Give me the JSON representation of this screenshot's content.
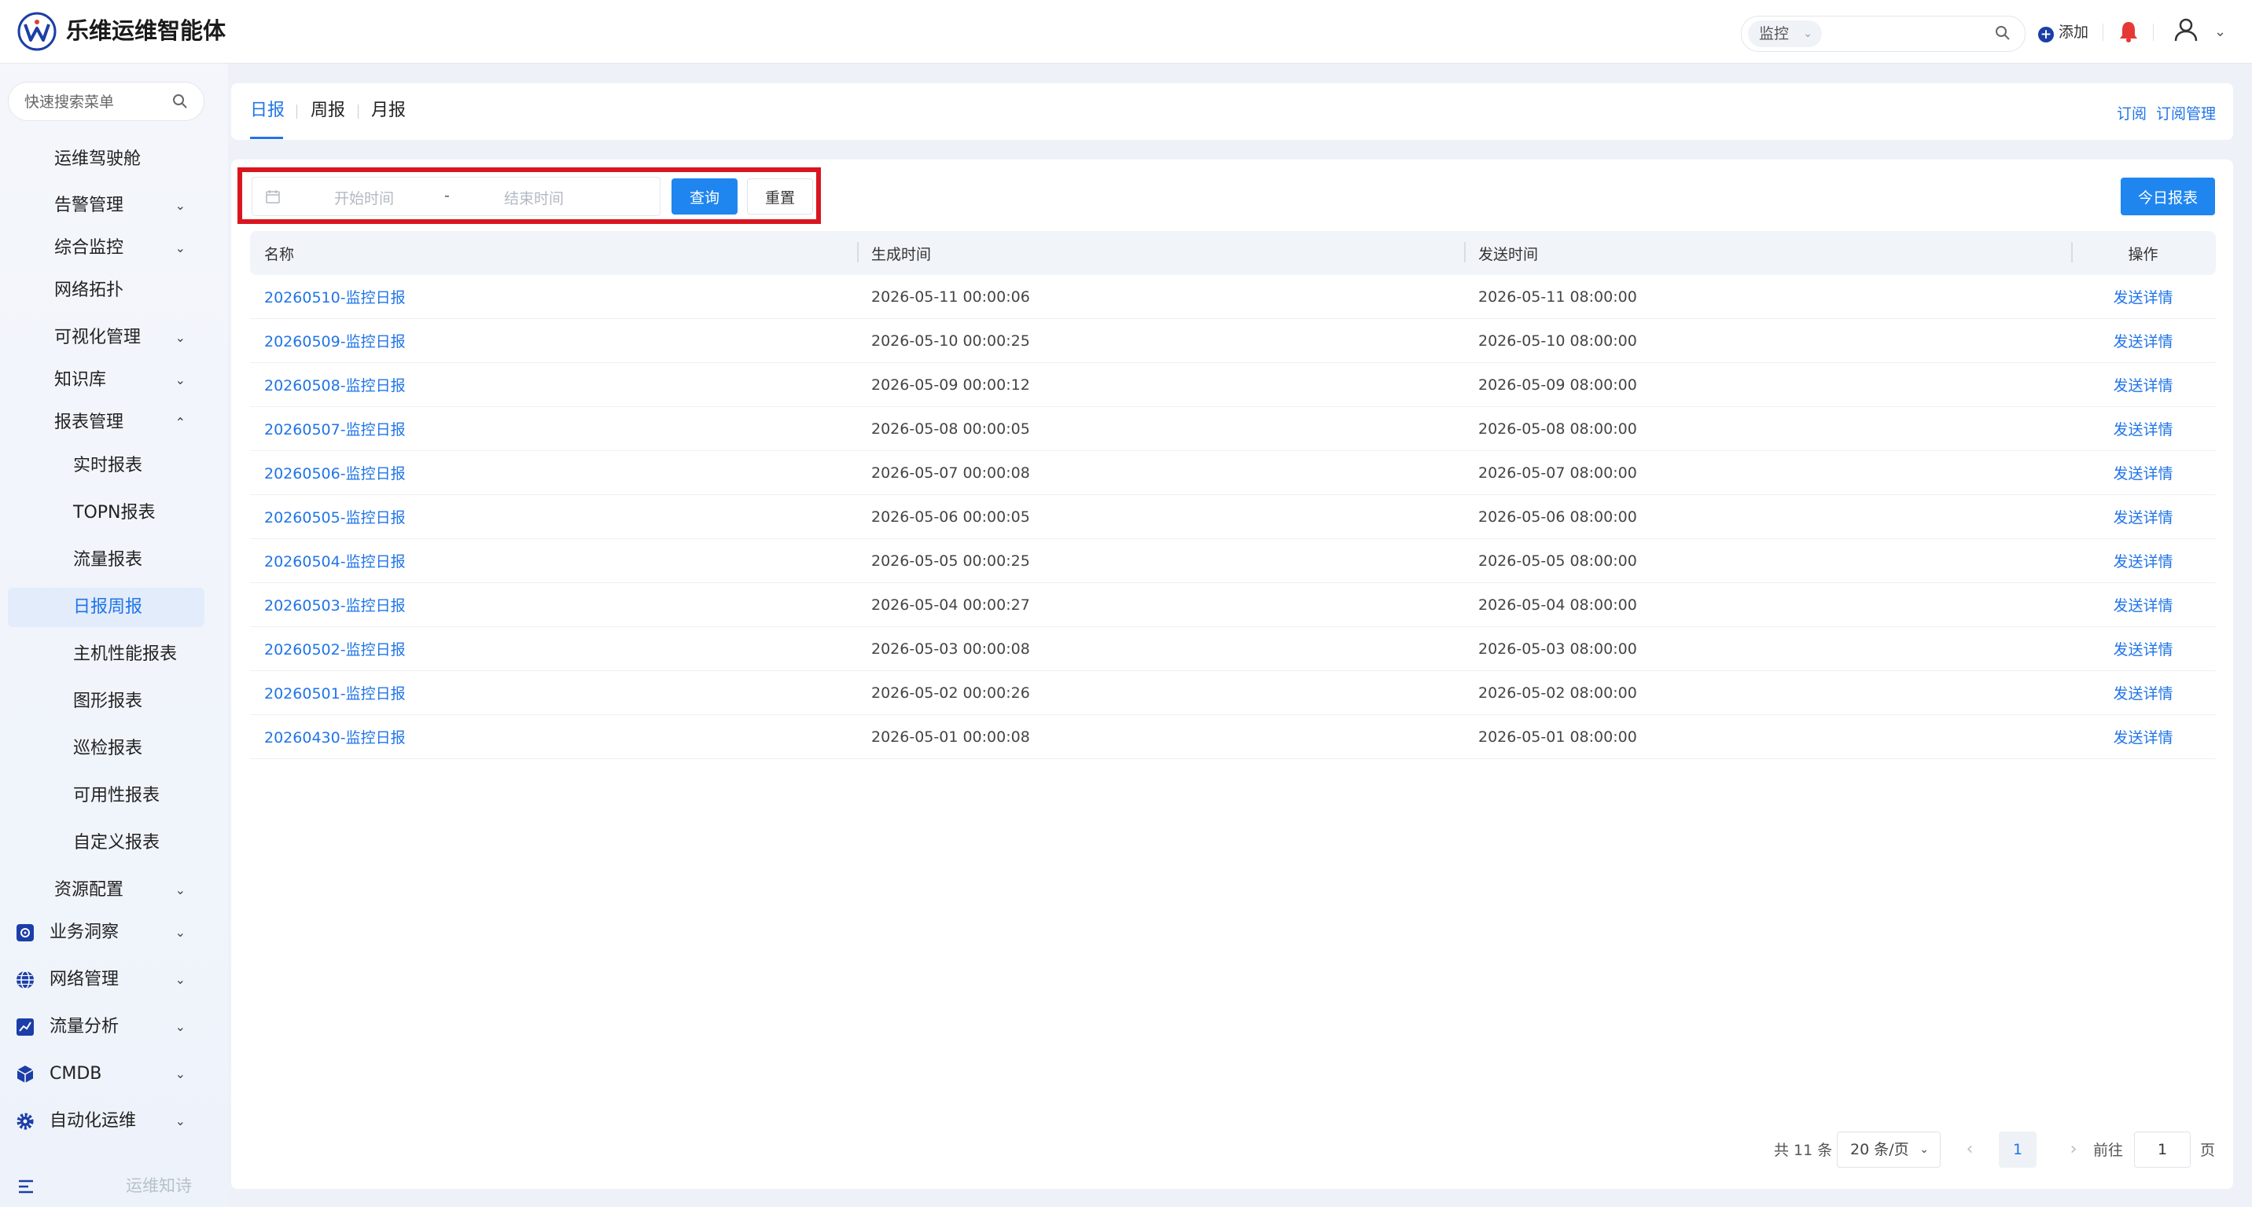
{
  "app": {
    "title": "乐维运维智能体",
    "accent": "#1f74e8",
    "alert_color": "#e53935"
  },
  "topbar": {
    "search_scope": "监控",
    "add_label": "添加",
    "icons": [
      "search-icon",
      "add-icon",
      "bell-icon",
      "user-icon",
      "chevron-down-icon"
    ]
  },
  "sidebar": {
    "search_placeholder": "快速搜索菜单",
    "items": [
      {
        "label": "运维驾驶舱"
      },
      {
        "label": "告警管理"
      },
      {
        "label": "综合监控"
      },
      {
        "label": "网络拓扑"
      },
      {
        "label": "可视化管理"
      },
      {
        "label": "知识库"
      },
      {
        "label": "报表管理"
      }
    ],
    "report_children": [
      {
        "label": "实时报表"
      },
      {
        "label": "TOPN报表"
      },
      {
        "label": "流量报表"
      },
      {
        "label": "日报周报",
        "active": true
      },
      {
        "label": "主机性能报表"
      },
      {
        "label": "图形报表"
      },
      {
        "label": "巡检报表"
      },
      {
        "label": "可用性报表"
      },
      {
        "label": "自定义报表"
      }
    ],
    "after_items": [
      {
        "label": "资源配置"
      }
    ],
    "groups": [
      {
        "label": "业务洞察",
        "icon": "business-insight-icon"
      },
      {
        "label": "网络管理",
        "icon": "globe-icon"
      },
      {
        "label": "流量分析",
        "icon": "chart-icon"
      },
      {
        "label": "CMDB",
        "icon": "cube-icon"
      },
      {
        "label": "自动化运维",
        "icon": "gear-icon"
      }
    ],
    "footer_text": "运维知诗"
  },
  "tabs": {
    "items": [
      "日报",
      "周报",
      "月报"
    ],
    "active": "日报",
    "subscribe": "订阅",
    "subscribe_manage": "订阅管理"
  },
  "filters": {
    "start_placeholder": "开始时间",
    "end_placeholder": "结束时间",
    "range_sep": "-",
    "query": "查询",
    "reset": "重置",
    "today_report": "今日报表"
  },
  "table": {
    "columns": [
      "名称",
      "生成时间",
      "发送时间",
      "操作"
    ],
    "rows": [
      {
        "name": "20260510-监控日报",
        "generated": "2026-05-11 00:00:06",
        "sent": "2026-05-11 08:00:00",
        "action": "发送详情"
      },
      {
        "name": "20260509-监控日报",
        "generated": "2026-05-10 00:00:25",
        "sent": "2026-05-10 08:00:00",
        "action": "发送详情"
      },
      {
        "name": "20260508-监控日报",
        "generated": "2026-05-09 00:00:12",
        "sent": "2026-05-09 08:00:00",
        "action": "发送详情"
      },
      {
        "name": "20260507-监控日报",
        "generated": "2026-05-08 00:00:05",
        "sent": "2026-05-08 08:00:00",
        "action": "发送详情"
      },
      {
        "name": "20260506-监控日报",
        "generated": "2026-05-07 00:00:08",
        "sent": "2026-05-07 08:00:00",
        "action": "发送详情"
      },
      {
        "name": "20260505-监控日报",
        "generated": "2026-05-06 00:00:05",
        "sent": "2026-05-06 08:00:00",
        "action": "发送详情"
      },
      {
        "name": "20260504-监控日报",
        "generated": "2026-05-05 00:00:25",
        "sent": "2026-05-05 08:00:00",
        "action": "发送详情"
      },
      {
        "name": "20260503-监控日报",
        "generated": "2026-05-04 00:00:27",
        "sent": "2026-05-04 08:00:00",
        "action": "发送详情"
      },
      {
        "name": "20260502-监控日报",
        "generated": "2026-05-03 00:00:08",
        "sent": "2026-05-03 08:00:00",
        "action": "发送详情"
      },
      {
        "name": "20260501-监控日报",
        "generated": "2026-05-02 00:00:26",
        "sent": "2026-05-02 08:00:00",
        "action": "发送详情"
      },
      {
        "name": "20260430-监控日报",
        "generated": "2026-05-01 00:00:08",
        "sent": "2026-05-01 08:00:00",
        "action": "发送详情"
      }
    ]
  },
  "pagination": {
    "total_text": "共 11 条",
    "page_size": "20 条/页",
    "current_page": "1",
    "goto_label": "前往",
    "goto_value": "1",
    "page_suffix": "页"
  }
}
